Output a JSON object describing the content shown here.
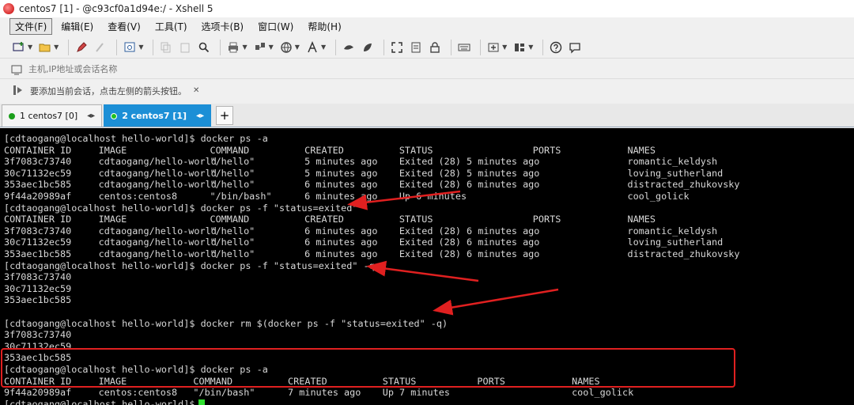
{
  "window": {
    "title": "centos7 [1] - @c93cf0a1d94e:/ - Xshell 5"
  },
  "menu": {
    "items": [
      "文件(F)",
      "编辑(E)",
      "查看(V)",
      "工具(T)",
      "选项卡(B)",
      "窗口(W)",
      "帮助(H)"
    ]
  },
  "address_bar": {
    "placeholder": "主机,IP地址或会话名称"
  },
  "hint_bar": {
    "text": "要添加当前会话，点击左侧的箭头按钮。"
  },
  "tabs": [
    {
      "label": "1 centos7 [0]",
      "active": false
    },
    {
      "label": "2 centos7 [1]",
      "active": true
    }
  ],
  "icons": [
    "new-session-icon",
    "open-folder-icon",
    "edit-icon",
    "properties-icon",
    "copy-icon",
    "paste-icon",
    "find-icon",
    "print-icon",
    "transfer-icon",
    "globe-icon",
    "font-icon",
    "xftp-icon",
    "xmanager-icon",
    "fullscreen-icon",
    "lock-icon",
    "keyboard-icon",
    "new-tab-icon",
    "layout-icon",
    "help-icon",
    "chat-icon"
  ],
  "terminal": {
    "lines": [
      [
        {
          "c": 0,
          "t": "[cdtaogang@localhost hello-world]$ docker ps -a"
        }
      ],
      [
        {
          "c": 0,
          "t": "CONTAINER ID"
        },
        {
          "c": 17,
          "t": "IMAGE"
        },
        {
          "c": 37,
          "t": "COMMAND"
        },
        {
          "c": 54,
          "t": "CREATED"
        },
        {
          "c": 71,
          "t": "STATUS"
        },
        {
          "c": 95,
          "t": "PORTS"
        },
        {
          "c": 112,
          "t": "NAMES"
        }
      ],
      [
        {
          "c": 0,
          "t": "3f7083c73740"
        },
        {
          "c": 17,
          "t": "cdtaogang/hello-world"
        },
        {
          "c": 37,
          "t": "\"/hello\""
        },
        {
          "c": 54,
          "t": "5 minutes ago"
        },
        {
          "c": 71,
          "t": "Exited (28) 5 minutes ago"
        },
        {
          "c": 112,
          "t": "romantic_keldysh"
        }
      ],
      [
        {
          "c": 0,
          "t": "30c71132ec59"
        },
        {
          "c": 17,
          "t": "cdtaogang/hello-world"
        },
        {
          "c": 37,
          "t": "\"/hello\""
        },
        {
          "c": 54,
          "t": "5 minutes ago"
        },
        {
          "c": 71,
          "t": "Exited (28) 5 minutes ago"
        },
        {
          "c": 112,
          "t": "loving_sutherland"
        }
      ],
      [
        {
          "c": 0,
          "t": "353aec1bc585"
        },
        {
          "c": 17,
          "t": "cdtaogang/hello-world"
        },
        {
          "c": 37,
          "t": "\"/hello\""
        },
        {
          "c": 54,
          "t": "6 minutes ago"
        },
        {
          "c": 71,
          "t": "Exited (28) 6 minutes ago"
        },
        {
          "c": 112,
          "t": "distracted_zhukovsky"
        }
      ],
      [
        {
          "c": 0,
          "t": "9f44a20989af"
        },
        {
          "c": 17,
          "t": "centos:centos8"
        },
        {
          "c": 37,
          "t": "\"/bin/bash\""
        },
        {
          "c": 54,
          "t": "6 minutes ago"
        },
        {
          "c": 71,
          "t": "Up 6 minutes"
        },
        {
          "c": 112,
          "t": "cool_golick"
        }
      ],
      [
        {
          "c": 0,
          "t": "[cdtaogang@localhost hello-world]$ docker ps -f \"status=exited\""
        }
      ],
      [
        {
          "c": 0,
          "t": "CONTAINER ID"
        },
        {
          "c": 17,
          "t": "IMAGE"
        },
        {
          "c": 37,
          "t": "COMMAND"
        },
        {
          "c": 54,
          "t": "CREATED"
        },
        {
          "c": 71,
          "t": "STATUS"
        },
        {
          "c": 95,
          "t": "PORTS"
        },
        {
          "c": 112,
          "t": "NAMES"
        }
      ],
      [
        {
          "c": 0,
          "t": "3f7083c73740"
        },
        {
          "c": 17,
          "t": "cdtaogang/hello-world"
        },
        {
          "c": 37,
          "t": "\"/hello\""
        },
        {
          "c": 54,
          "t": "6 minutes ago"
        },
        {
          "c": 71,
          "t": "Exited (28) 6 minutes ago"
        },
        {
          "c": 112,
          "t": "romantic_keldysh"
        }
      ],
      [
        {
          "c": 0,
          "t": "30c71132ec59"
        },
        {
          "c": 17,
          "t": "cdtaogang/hello-world"
        },
        {
          "c": 37,
          "t": "\"/hello\""
        },
        {
          "c": 54,
          "t": "6 minutes ago"
        },
        {
          "c": 71,
          "t": "Exited (28) 6 minutes ago"
        },
        {
          "c": 112,
          "t": "loving_sutherland"
        }
      ],
      [
        {
          "c": 0,
          "t": "353aec1bc585"
        },
        {
          "c": 17,
          "t": "cdtaogang/hello-world"
        },
        {
          "c": 37,
          "t": "\"/hello\""
        },
        {
          "c": 54,
          "t": "6 minutes ago"
        },
        {
          "c": 71,
          "t": "Exited (28) 6 minutes ago"
        },
        {
          "c": 112,
          "t": "distracted_zhukovsky"
        }
      ],
      [
        {
          "c": 0,
          "t": "[cdtaogang@localhost hello-world]$ docker ps -f \"status=exited\" -q"
        }
      ],
      [
        {
          "c": 0,
          "t": "3f7083c73740"
        }
      ],
      [
        {
          "c": 0,
          "t": "30c71132ec59"
        }
      ],
      [
        {
          "c": 0,
          "t": "353aec1bc585"
        }
      ],
      [],
      [
        {
          "c": 0,
          "t": "[cdtaogang@localhost hello-world]$ docker rm $(docker ps -f \"status=exited\" -q)"
        }
      ],
      [
        {
          "c": 0,
          "t": "3f7083c73740"
        }
      ],
      [
        {
          "c": 0,
          "t": "30c71132ec59"
        }
      ],
      [
        {
          "c": 0,
          "t": "353aec1bc585"
        }
      ],
      [
        {
          "c": 0,
          "t": "[cdtaogang@localhost hello-world]$ docker ps -a"
        }
      ],
      [
        {
          "c": 0,
          "t": "CONTAINER ID"
        },
        {
          "c": 17,
          "t": "IMAGE"
        },
        {
          "c": 34,
          "t": "COMMAND"
        },
        {
          "c": 51,
          "t": "CREATED"
        },
        {
          "c": 68,
          "t": "STATUS"
        },
        {
          "c": 85,
          "t": "PORTS"
        },
        {
          "c": 102,
          "t": "NAMES"
        }
      ],
      [
        {
          "c": 0,
          "t": "9f44a20989af"
        },
        {
          "c": 17,
          "t": "centos:centos8"
        },
        {
          "c": 34,
          "t": "\"/bin/bash\""
        },
        {
          "c": 51,
          "t": "7 minutes ago"
        },
        {
          "c": 68,
          "t": "Up 7 minutes"
        },
        {
          "c": 102,
          "t": "cool_golick"
        }
      ],
      [
        {
          "c": 0,
          "t": "[cdtaogang@localhost hello-world]$ "
        }
      ]
    ]
  },
  "annotation_colors": {
    "arrow": "#e02020",
    "highlight_box": "#e02020",
    "active_tab": "#1c8fd6",
    "cursor": "#2fe02f"
  }
}
